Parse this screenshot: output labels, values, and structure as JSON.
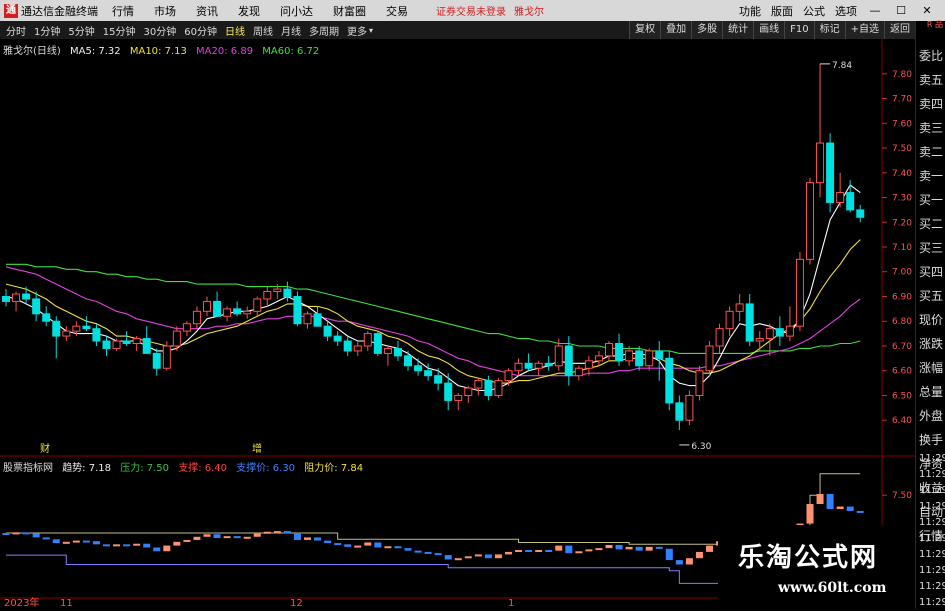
{
  "menubar": {
    "app_name": "通达信金融终端",
    "items": [
      "行情",
      "市场",
      "资讯",
      "发现",
      "问小达",
      "财富圈",
      "交易"
    ],
    "warning": "证券交易未登录",
    "stock_name": "雅戈尔",
    "right_items": [
      "功能",
      "版面",
      "公式",
      "选项"
    ],
    "window_controls": [
      "minimize-icon",
      "maximize-icon",
      "close-icon"
    ]
  },
  "toolbar": {
    "periods": [
      "分时",
      "1分钟",
      "5分钟",
      "15分钟",
      "30分钟",
      "60分钟",
      "日线",
      "周线",
      "月线",
      "多周期",
      "更多"
    ],
    "selected": "日线",
    "right_buttons": [
      "复权",
      "叠加",
      "多股",
      "统计",
      "画线",
      "F10",
      "标记",
      "+自选",
      "返回"
    ]
  },
  "main_header": {
    "title": "雅戈尔(日线)",
    "ma5": "MA5: 7.32",
    "ma10": "MA10: 7.13",
    "ma20": "MA20: 6.89",
    "ma60": "MA60: 6.72"
  },
  "sub_header": {
    "title": "股票指标网",
    "trend": "趋势: 7.18",
    "pressure": "压力: 7.50",
    "support": "支撑: 6.40",
    "support_price": "支撑价: 6.30",
    "resist_price": "阻力价: 7.84"
  },
  "side_panel": {
    "tag": "R\n品",
    "items": [
      "委比",
      "卖五",
      "卖四",
      "卖三",
      "卖二",
      "卖一",
      "买一",
      "买二",
      "买三",
      "买四",
      "买五",
      "现价",
      "涨跌",
      "涨幅",
      "总量",
      "外盘",
      "换手",
      "净资",
      "收益",
      "自动",
      "行情"
    ],
    "times": [
      "11:29",
      "11:29",
      "11:29",
      "11:29",
      "11:29",
      "11:29",
      "11:29",
      "11:29",
      "11:29",
      "11:29"
    ]
  },
  "markers": {
    "fin": "财",
    "inc": "增"
  },
  "date_axis": {
    "year_label": "2023年",
    "month_labels": [
      "11",
      "12",
      "1"
    ]
  },
  "watermark": {
    "brand": "乐淘公式网",
    "url": "www.60lt.com"
  },
  "colors": {
    "up": "#ff5050",
    "down": "#00e0e0",
    "ma5": "#ffffff",
    "ma10": "#f0e040",
    "ma20": "#e040e0",
    "ma60": "#40e040"
  },
  "chart_data": {
    "type": "candlestick",
    "title": "雅戈尔(日线)",
    "ylim": [
      6.32,
      7.88
    ],
    "yticks": [
      7.8,
      7.7,
      7.6,
      7.5,
      7.4,
      7.3,
      7.2,
      7.1,
      7.0,
      6.9,
      6.8,
      6.7,
      6.6,
      6.5,
      6.4
    ],
    "annotations": [
      {
        "label": "7.84",
        "value": 7.84
      },
      {
        "label": "6.30",
        "value": 6.3
      }
    ],
    "candles": [
      [
        6.9,
        6.93,
        6.86,
        6.88
      ],
      [
        6.88,
        6.92,
        6.84,
        6.91
      ],
      [
        6.91,
        6.94,
        6.87,
        6.89
      ],
      [
        6.89,
        6.92,
        6.8,
        6.83
      ],
      [
        6.83,
        6.86,
        6.78,
        6.8
      ],
      [
        6.8,
        6.82,
        6.65,
        6.74
      ],
      [
        6.74,
        6.78,
        6.72,
        6.76
      ],
      [
        6.76,
        6.8,
        6.74,
        6.78
      ],
      [
        6.78,
        6.82,
        6.76,
        6.77
      ],
      [
        6.77,
        6.79,
        6.7,
        6.72
      ],
      [
        6.72,
        6.74,
        6.66,
        6.69
      ],
      [
        6.69,
        6.73,
        6.68,
        6.72
      ],
      [
        6.72,
        6.76,
        6.7,
        6.71
      ],
      [
        6.71,
        6.74,
        6.68,
        6.73
      ],
      [
        6.73,
        6.78,
        6.7,
        6.67
      ],
      [
        6.67,
        6.69,
        6.58,
        6.61
      ],
      [
        6.61,
        6.72,
        6.6,
        6.7
      ],
      [
        6.7,
        6.78,
        6.68,
        6.76
      ],
      [
        6.76,
        6.8,
        6.74,
        6.79
      ],
      [
        6.79,
        6.86,
        6.77,
        6.84
      ],
      [
        6.84,
        6.9,
        6.82,
        6.88
      ],
      [
        6.88,
        6.92,
        6.84,
        6.82
      ],
      [
        6.82,
        6.86,
        6.8,
        6.85
      ],
      [
        6.85,
        6.88,
        6.82,
        6.83
      ],
      [
        6.83,
        6.86,
        6.81,
        6.84
      ],
      [
        6.84,
        6.9,
        6.82,
        6.89
      ],
      [
        6.89,
        6.94,
        6.86,
        6.92
      ],
      [
        6.92,
        6.95,
        6.89,
        6.93
      ],
      [
        6.93,
        6.96,
        6.88,
        6.9
      ],
      [
        6.9,
        6.92,
        6.78,
        6.79
      ],
      [
        6.79,
        6.84,
        6.77,
        6.83
      ],
      [
        6.83,
        6.86,
        6.8,
        6.78
      ],
      [
        6.78,
        6.8,
        6.72,
        6.74
      ],
      [
        6.74,
        6.76,
        6.7,
        6.72
      ],
      [
        6.72,
        6.74,
        6.66,
        6.68
      ],
      [
        6.68,
        6.72,
        6.66,
        6.7
      ],
      [
        6.7,
        6.76,
        6.68,
        6.75
      ],
      [
        6.75,
        6.76,
        6.66,
        6.67
      ],
      [
        6.67,
        6.7,
        6.62,
        6.69
      ],
      [
        6.69,
        6.72,
        6.64,
        6.66
      ],
      [
        6.66,
        6.68,
        6.6,
        6.62
      ],
      [
        6.62,
        6.65,
        6.58,
        6.6
      ],
      [
        6.6,
        6.63,
        6.56,
        6.58
      ],
      [
        6.58,
        6.61,
        6.52,
        6.55
      ],
      [
        6.55,
        6.59,
        6.44,
        6.48
      ],
      [
        6.48,
        6.51,
        6.44,
        6.5
      ],
      [
        6.5,
        6.54,
        6.47,
        6.53
      ],
      [
        6.53,
        6.57,
        6.5,
        6.56
      ],
      [
        6.56,
        6.58,
        6.48,
        6.5
      ],
      [
        6.5,
        6.57,
        6.49,
        6.56
      ],
      [
        6.56,
        6.61,
        6.54,
        6.6
      ],
      [
        6.6,
        6.65,
        6.58,
        6.63
      ],
      [
        6.63,
        6.67,
        6.6,
        6.61
      ],
      [
        6.61,
        6.64,
        6.58,
        6.63
      ],
      [
        6.63,
        6.66,
        6.6,
        6.62
      ],
      [
        6.62,
        6.73,
        6.6,
        6.7
      ],
      [
        6.7,
        6.74,
        6.54,
        6.58
      ],
      [
        6.58,
        6.62,
        6.56,
        6.61
      ],
      [
        6.61,
        6.66,
        6.58,
        6.64
      ],
      [
        6.64,
        6.68,
        6.62,
        6.66
      ],
      [
        6.66,
        6.72,
        6.64,
        6.71
      ],
      [
        6.71,
        6.75,
        6.62,
        6.64
      ],
      [
        6.64,
        6.7,
        6.62,
        6.68
      ],
      [
        6.68,
        6.7,
        6.6,
        6.62
      ],
      [
        6.62,
        6.69,
        6.6,
        6.68
      ],
      [
        6.68,
        6.72,
        6.56,
        6.65
      ],
      [
        6.65,
        6.68,
        6.44,
        6.47
      ],
      [
        6.47,
        6.5,
        6.36,
        6.4
      ],
      [
        6.4,
        6.52,
        6.38,
        6.5
      ],
      [
        6.5,
        6.62,
        6.48,
        6.6
      ],
      [
        6.6,
        6.72,
        6.58,
        6.7
      ],
      [
        6.7,
        6.79,
        6.67,
        6.77
      ],
      [
        6.77,
        6.86,
        6.74,
        6.84
      ],
      [
        6.84,
        6.91,
        6.8,
        6.87
      ],
      [
        6.87,
        6.91,
        6.7,
        6.72
      ],
      [
        6.72,
        6.76,
        6.68,
        6.73
      ],
      [
        6.73,
        6.79,
        6.66,
        6.77
      ],
      [
        6.77,
        6.82,
        6.7,
        6.74
      ],
      [
        6.74,
        6.86,
        6.72,
        6.78
      ],
      [
        6.78,
        7.08,
        6.76,
        7.05
      ],
      [
        7.05,
        7.38,
        7.03,
        7.36
      ],
      [
        7.36,
        7.84,
        7.3,
        7.52
      ],
      [
        7.52,
        7.56,
        7.24,
        7.28
      ],
      [
        7.28,
        7.4,
        7.26,
        7.32
      ],
      [
        7.32,
        7.37,
        7.24,
        7.25
      ],
      [
        7.25,
        7.27,
        7.2,
        7.22
      ]
    ],
    "ma5": [
      6.9,
      6.89,
      6.87,
      6.85,
      6.82,
      6.79,
      6.76,
      6.75,
      6.75,
      6.75,
      6.74,
      6.72,
      6.72,
      6.72,
      6.7,
      6.68,
      6.68,
      6.69,
      6.72,
      6.76,
      6.81,
      6.82,
      6.83,
      6.84,
      6.84,
      6.85,
      6.86,
      6.88,
      6.9,
      6.88,
      6.86,
      6.83,
      6.8,
      6.77,
      6.74,
      6.72,
      6.72,
      6.71,
      6.7,
      6.69,
      6.67,
      6.64,
      6.61,
      6.6,
      6.57,
      6.54,
      6.53,
      6.52,
      6.52,
      6.53,
      6.55,
      6.58,
      6.6,
      6.61,
      6.62,
      6.64,
      6.63,
      6.63,
      6.63,
      6.64,
      6.66,
      6.66,
      6.67,
      6.67,
      6.66,
      6.64,
      6.58,
      6.55,
      6.54,
      6.54,
      6.58,
      6.65,
      6.73,
      6.79,
      6.78,
      6.79,
      6.78,
      6.76,
      6.75,
      6.81,
      6.91,
      7.06,
      7.21,
      7.28,
      7.35,
      7.32
    ],
    "ma10": [
      6.95,
      6.94,
      6.93,
      6.91,
      6.89,
      6.86,
      6.84,
      6.82,
      6.8,
      6.79,
      6.77,
      6.74,
      6.74,
      6.73,
      6.72,
      6.71,
      6.7,
      6.7,
      6.71,
      6.73,
      6.75,
      6.76,
      6.77,
      6.78,
      6.8,
      6.82,
      6.84,
      6.85,
      6.87,
      6.87,
      6.86,
      6.86,
      6.85,
      6.83,
      6.8,
      6.78,
      6.77,
      6.76,
      6.74,
      6.73,
      6.71,
      6.68,
      6.66,
      6.65,
      6.63,
      6.6,
      6.58,
      6.57,
      6.56,
      6.55,
      6.55,
      6.56,
      6.56,
      6.57,
      6.58,
      6.59,
      6.59,
      6.6,
      6.61,
      6.62,
      6.64,
      6.64,
      6.65,
      6.65,
      6.65,
      6.65,
      6.63,
      6.62,
      6.6,
      6.59,
      6.59,
      6.6,
      6.62,
      6.64,
      6.66,
      6.69,
      6.72,
      6.75,
      6.77,
      6.8,
      6.85,
      6.92,
      6.98,
      7.03,
      7.09,
      7.13
    ],
    "ma20": [
      7.02,
      7.01,
      7.0,
      6.99,
      6.97,
      6.95,
      6.93,
      6.91,
      6.89,
      6.88,
      6.86,
      6.84,
      6.83,
      6.81,
      6.8,
      6.79,
      6.78,
      6.77,
      6.77,
      6.77,
      6.77,
      6.78,
      6.78,
      6.79,
      6.79,
      6.8,
      6.81,
      6.81,
      6.82,
      6.82,
      6.82,
      6.82,
      6.81,
      6.8,
      6.8,
      6.79,
      6.78,
      6.77,
      6.76,
      6.75,
      6.74,
      6.72,
      6.71,
      6.69,
      6.67,
      6.65,
      6.64,
      6.62,
      6.61,
      6.6,
      6.59,
      6.58,
      6.58,
      6.58,
      6.58,
      6.58,
      6.58,
      6.58,
      6.59,
      6.59,
      6.59,
      6.6,
      6.6,
      6.61,
      6.61,
      6.61,
      6.61,
      6.61,
      6.61,
      6.61,
      6.62,
      6.62,
      6.63,
      6.64,
      6.65,
      6.66,
      6.67,
      6.68,
      6.69,
      6.71,
      6.73,
      6.76,
      6.79,
      6.82,
      6.86,
      6.89
    ],
    "ma60": [
      7.03,
      7.03,
      7.03,
      7.02,
      7.02,
      7.02,
      7.01,
      7.01,
      7.0,
      7.0,
      6.99,
      6.99,
      6.98,
      6.98,
      6.97,
      6.97,
      6.96,
      6.96,
      6.96,
      6.95,
      6.95,
      6.95,
      6.95,
      6.95,
      6.94,
      6.94,
      6.94,
      6.94,
      6.94,
      6.93,
      6.93,
      6.92,
      6.91,
      6.9,
      6.89,
      6.88,
      6.87,
      6.86,
      6.85,
      6.84,
      6.83,
      6.82,
      6.81,
      6.8,
      6.79,
      6.78,
      6.77,
      6.76,
      6.75,
      6.75,
      6.74,
      6.73,
      6.73,
      6.72,
      6.72,
      6.71,
      6.71,
      6.7,
      6.7,
      6.7,
      6.69,
      6.69,
      6.69,
      6.69,
      6.68,
      6.68,
      6.68,
      6.67,
      6.67,
      6.67,
      6.67,
      6.67,
      6.67,
      6.67,
      6.67,
      6.68,
      6.68,
      6.68,
      6.68,
      6.69,
      6.69,
      6.7,
      6.7,
      6.71,
      6.71,
      6.72
    ]
  },
  "sub_chart_data": {
    "type": "indicator",
    "ylim": [
      5.9,
      7.9
    ],
    "ytick": 7.5,
    "pressure_line": [
      6.9,
      6.9,
      6.9,
      6.9,
      6.9,
      6.9,
      6.9,
      6.9,
      6.9,
      6.9,
      6.9,
      6.9,
      6.9,
      6.9,
      6.9,
      6.9,
      6.9,
      6.9,
      6.9,
      6.9,
      6.9,
      6.9,
      6.9,
      6.9,
      6.9,
      6.9,
      6.9,
      6.9,
      6.9,
      6.9,
      6.9,
      6.9,
      6.9,
      6.8,
      6.8,
      6.8,
      6.8,
      6.8,
      6.8,
      6.8,
      6.8,
      6.8,
      6.8,
      6.8,
      6.8,
      6.8,
      6.8,
      6.8,
      6.8,
      6.8,
      6.8,
      6.75,
      6.75,
      6.75,
      6.75,
      6.75,
      6.75,
      6.75,
      6.75,
      6.75,
      6.75,
      6.75,
      6.72,
      6.72,
      6.72,
      6.72,
      6.72,
      6.72,
      6.72,
      6.72,
      6.72,
      6.72,
      6.72,
      6.72,
      6.72,
      6.72,
      6.72,
      6.72,
      6.72,
      6.72,
      7.5,
      7.84,
      7.84,
      7.84,
      7.84,
      7.84
    ],
    "support_line": [
      6.55,
      6.55,
      6.55,
      6.55,
      6.55,
      6.55,
      6.4,
      6.4,
      6.4,
      6.4,
      6.4,
      6.4,
      6.4,
      6.4,
      6.4,
      6.4,
      6.4,
      6.4,
      6.4,
      6.4,
      6.4,
      6.4,
      6.4,
      6.4,
      6.4,
      6.4,
      6.4,
      6.4,
      6.4,
      6.4,
      6.4,
      6.4,
      6.4,
      6.4,
      6.4,
      6.4,
      6.4,
      6.4,
      6.4,
      6.4,
      6.4,
      6.4,
      6.4,
      6.4,
      6.35,
      6.35,
      6.35,
      6.35,
      6.35,
      6.35,
      6.35,
      6.35,
      6.35,
      6.35,
      6.35,
      6.35,
      6.35,
      6.35,
      6.35,
      6.35,
      6.35,
      6.35,
      6.35,
      6.35,
      6.35,
      6.35,
      6.3,
      6.1,
      6.1,
      6.1,
      6.1,
      6.1,
      6.1,
      6.1,
      6.1,
      6.1,
      6.1,
      6.1,
      6.1,
      6.1,
      6.1,
      6.1,
      6.1,
      6.1,
      6.1,
      6.1
    ]
  }
}
